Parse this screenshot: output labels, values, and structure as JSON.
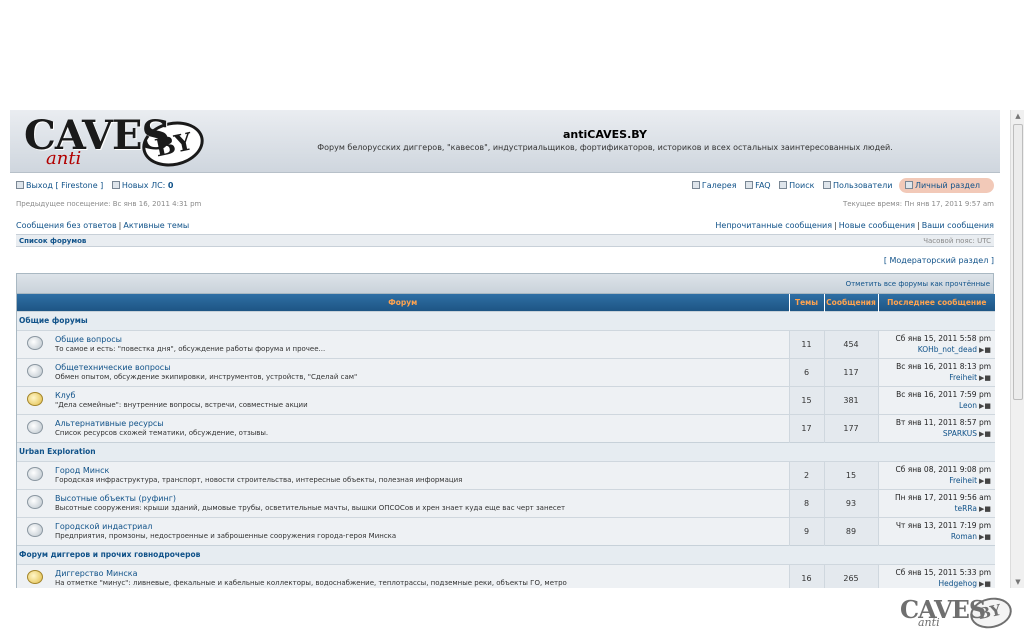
{
  "header": {
    "logo_text": "CAVES",
    "logo_anti": "anti",
    "logo_by": "BY",
    "title": "antiCAVES.BY",
    "description": "Форум белорусских диггеров, \"кавесов\", индустриальщиков, фортификаторов, историков и всех остальных заинтересованных людей."
  },
  "top_menu": {
    "logout": "Выход [ Firestone ]",
    "new_pm_label": "Новых ЛС:",
    "new_pm_count": "0",
    "gallery": "Галерея",
    "faq": "FAQ",
    "search": "Поиск",
    "users": "Пользователи",
    "personal": "Личный раздел"
  },
  "visit_info": {
    "last_visit": "Предыдущее посещение: Вс янв 16, 2011 4:31 pm",
    "current_time": "Текущее время: Пн янв 17, 2011 9:57 am"
  },
  "quick_links": {
    "unanswered": "Сообщения без ответов",
    "active": "Активные темы",
    "unread": "Непрочитанные сообщения",
    "new_posts": "Новые сообщения",
    "your_posts": "Ваши сообщения"
  },
  "breadcrumb": {
    "label": "Список форумов",
    "timezone": "Часовой пояс: UTC"
  },
  "moderator_link": "[ Модераторский раздел ]",
  "table": {
    "mark_all_read": "Отметить все форумы как прочтённые",
    "columns": {
      "forum": "Форум",
      "topics": "Темы",
      "posts": "Сообщения",
      "last_post": "Последнее сообщение"
    },
    "categories": [
      {
        "name": "Общие форумы",
        "forums": [
          {
            "title": "Общие вопросы",
            "desc": "То самое и есть: \"повестка дня\", обсуждение работы форума и прочее...",
            "topics": "11",
            "posts": "454",
            "last_date": "Сб янв 15, 2011 5:58 pm",
            "last_user": "KOHb_not_dead",
            "new": false
          },
          {
            "title": "Общетехнические вопросы",
            "desc": "Обмен опытом, обсуждение экипировки, инструментов, устройств, \"Сделай сам\"",
            "topics": "6",
            "posts": "117",
            "last_date": "Вс янв 16, 2011 8:13 pm",
            "last_user": "Freiheit",
            "new": false
          },
          {
            "title": "Клуб",
            "desc": "\"Дела семейные\": внутренние вопросы, встречи, совместные акции",
            "topics": "15",
            "posts": "381",
            "last_date": "Вс янв 16, 2011 7:59 pm",
            "last_user": "Leon",
            "new": true
          },
          {
            "title": "Альтернативные ресурсы",
            "desc": "Список ресурсов схожей тематики, обсуждение, отзывы.",
            "topics": "17",
            "posts": "177",
            "last_date": "Вт янв 11, 2011 8:57 pm",
            "last_user": "SPARKUS",
            "new": false
          }
        ]
      },
      {
        "name": "Urban Exploration",
        "forums": [
          {
            "title": "Город Минск",
            "desc": "Городская инфраструктура, транспорт, новости строительства, интересные объекты, полезная информация",
            "topics": "2",
            "posts": "15",
            "last_date": "Сб янв 08, 2011 9:08 pm",
            "last_user": "Freiheit",
            "new": false
          },
          {
            "title": "Высотные объекты (руфинг)",
            "desc": "Высотные сооружения: крыши зданий, дымовые трубы, осветительные мачты, вышки ОПСОСов и хрен знает куда еще вас черт занесет",
            "topics": "8",
            "posts": "93",
            "last_date": "Пн янв 17, 2011 9:56 am",
            "last_user": "teRRa",
            "new": false
          },
          {
            "title": "Городской индастриал",
            "desc": "Предприятия, промзоны, недостроенные и заброшенные сооружения города-героя Минска",
            "topics": "9",
            "posts": "89",
            "last_date": "Чт янв 13, 2011 7:19 pm",
            "last_user": "Roman",
            "new": false
          }
        ]
      },
      {
        "name": "Форум диггеров и прочих говнодрочеров",
        "forums": [
          {
            "title": "Диггерство Минска",
            "desc": "На отметке \"минус\": ливневые, фекальные и кабельные коллекторы, водоснабжение, теплотрассы, подземные реки, объекты ГО, метро",
            "topics": "16",
            "posts": "265",
            "last_date": "Сб янв 15, 2011 5:33 pm",
            "last_user": "Hedgehog",
            "new": true
          }
        ]
      }
    ]
  },
  "watermark": {
    "caves": "CAVES",
    "anti": "anti",
    "by": "BY"
  }
}
